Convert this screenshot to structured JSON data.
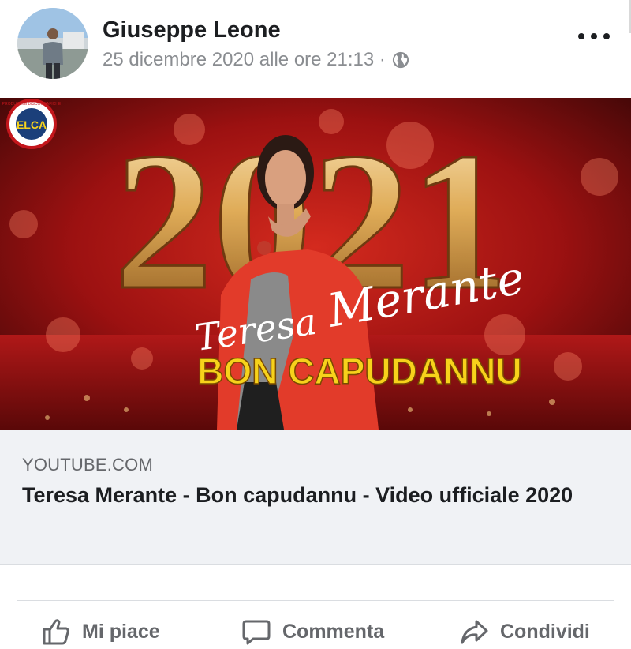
{
  "post": {
    "author": "Giuseppe Leone",
    "timestamp": "25 dicembre 2020 alle ore 21:13 ·",
    "privacy_icon": "globe-icon",
    "more_icon": "more-options-icon"
  },
  "media": {
    "year_text": "2021",
    "script_first": "Teresa",
    "script_last": "Merante",
    "subtitle": "BON CAPUDANNU",
    "badge_text": "PRODUZIONI DISCOGRAFICHE",
    "badge_logo": "ELCA",
    "colors": {
      "bg_dark": "#5a0b0b",
      "bg_red": "#b31515",
      "gold": "#e8c36b",
      "jacket": "#e23b2a",
      "yellow": "#f7d21b"
    }
  },
  "link": {
    "domain": "YOUTUBE.COM",
    "title": "Teresa Merante - Bon capudannu - Video ufficiale 2020"
  },
  "actions": {
    "like": "Mi piace",
    "comment": "Commenta",
    "share": "Condividi"
  }
}
